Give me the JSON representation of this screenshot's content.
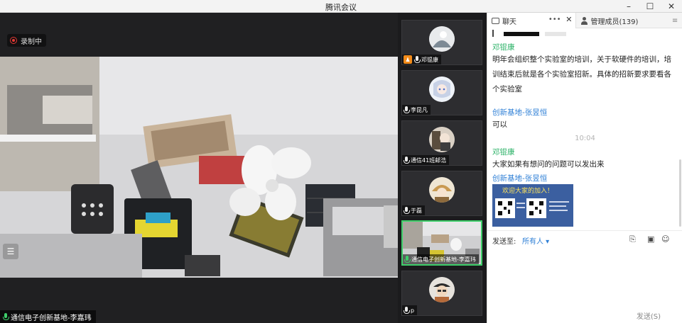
{
  "window": {
    "title": "腾讯会议"
  },
  "recording": {
    "label": "录制中"
  },
  "main_video": {
    "speaker_name": "通信电子创新基地-李嘉玮"
  },
  "participants": [
    {
      "name": "邓锟康",
      "is_host": true
    },
    {
      "name": "李昆凡",
      "is_host": false
    },
    {
      "name": "通信41班邮浩",
      "is_host": false
    },
    {
      "name": "于磊",
      "is_host": false
    },
    {
      "name": "通信电子创新基地-李嘉玮",
      "is_host": false,
      "active": true
    },
    {
      "name": "p",
      "is_host": false
    }
  ],
  "panel": {
    "chat_tab": "聊天",
    "members_tab": "管理成员(139)",
    "more": "•••",
    "close": "✕",
    "menu": "≡"
  },
  "messages": [
    {
      "sender": "邓锟康",
      "text": "明年会组织整个实验室的培训，关于软硬件的培训，培训结束后就是各个实验室招新。具体的招新要求要看各个实验室"
    },
    {
      "sender": "创新基地-张昱恒",
      "text": "可以"
    },
    {
      "timestamp": "10:04"
    },
    {
      "sender": "邓锟康",
      "text": "大家如果有想问的问题可以发出来"
    },
    {
      "sender": "创新基地-张昱恒",
      "image_caption": "欢迎大家的加入！"
    }
  ],
  "composer": {
    "send_to_label": "发送至:",
    "send_to_value": "所有人 ▾",
    "send_button": "发送(S)"
  },
  "colors": {
    "accent_green": "#3ecf6a",
    "sender_green": "#2fb36a",
    "sender_blue": "#2e7fd6",
    "record_red": "#e53935"
  }
}
